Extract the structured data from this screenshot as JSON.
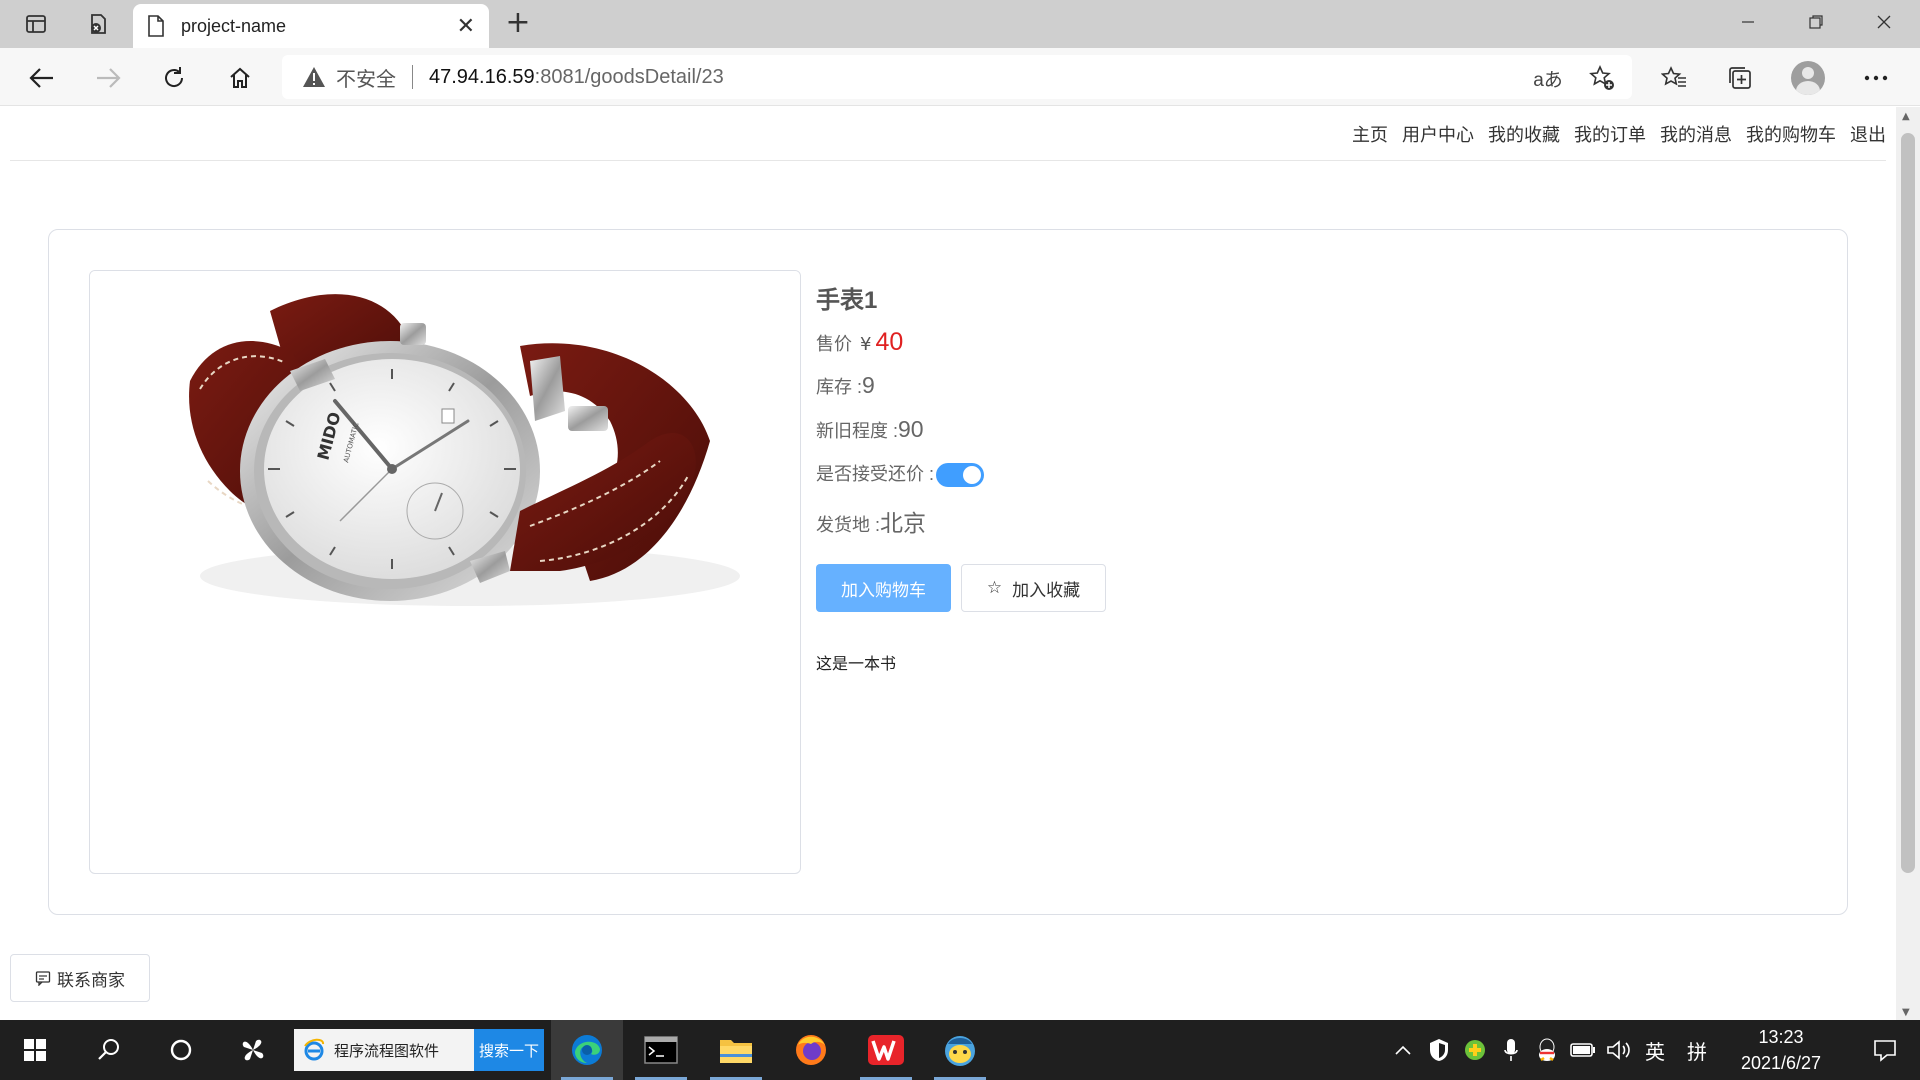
{
  "browser": {
    "tab_title": "project-name",
    "insecure_label": "不安全",
    "url_host": "47.94.16.59",
    "url_path": ":8081/goodsDetail/23",
    "read_aloud_label": "aあ"
  },
  "nav": {
    "items": [
      "主页",
      "用户中心",
      "我的收藏",
      "我的订单",
      "我的消息",
      "我的购物车",
      "退出"
    ]
  },
  "product": {
    "title": "手表1",
    "price_label": "售价",
    "currency": "¥",
    "price": "40",
    "stock_label": "库存 :",
    "stock": "9",
    "condition_label": "新旧程度 :",
    "condition": "90",
    "bargain_label": "是否接受还价 :",
    "bargain_accepted": true,
    "origin_label": "发货地 :",
    "origin": "北京",
    "add_cart_label": "加入购物车",
    "add_fav_label": "加入收藏",
    "description": "这是一本书",
    "image": {
      "brand_text": "MIDO",
      "dial_text": "AUTOMATIC"
    }
  },
  "contact_label": "联系商家",
  "taskbar": {
    "search_text": "程序流程图软件",
    "search_button": "搜索一下",
    "ime_label": "英",
    "ime_mode": "拼",
    "time": "13:23",
    "date": "2021/6/27"
  },
  "colors": {
    "accent": "#409eff",
    "button_primary": "#66b1ff",
    "price": "#e02020",
    "taskbar": "#1f1f1f"
  }
}
